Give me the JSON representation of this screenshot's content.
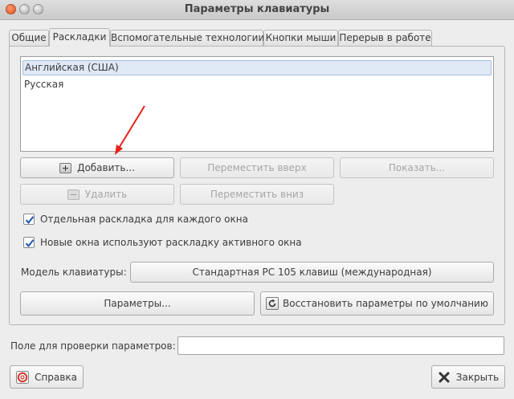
{
  "window": {
    "title": "Параметры клавиатуры"
  },
  "tabs": [
    {
      "label": "Общие"
    },
    {
      "label": "Раскладки"
    },
    {
      "label": "Вспомогательные технологии"
    },
    {
      "label": "Кнопки мыши"
    },
    {
      "label": "Перерыв в работе"
    }
  ],
  "layouts": {
    "items": [
      {
        "label": "Английская (США)",
        "selected": true
      },
      {
        "label": "Русская",
        "selected": false
      }
    ]
  },
  "buttons": {
    "add": "Добавить...",
    "move_up": "Переместить вверх",
    "show": "Показать...",
    "remove": "Удалить",
    "move_down": "Переместить вниз",
    "params": "Параметры...",
    "restore": "Восстановить параметры по умолчанию",
    "help": "Справка",
    "close": "Закрыть"
  },
  "options": {
    "separate_layout": {
      "label": "Отдельная раскладка для каждого окна",
      "checked": true
    },
    "new_windows": {
      "label": "Новые окна используют раскладку активного окна",
      "checked": true
    }
  },
  "model": {
    "label": "Модель клавиатуры:",
    "value": "Стандартная PC 105 клавиш (международная)"
  },
  "test": {
    "label": "Поле для проверки параметров:",
    "value": ""
  },
  "colors": {
    "annotation_arrow": "#e8201c",
    "selection": "#dfe9f6"
  }
}
